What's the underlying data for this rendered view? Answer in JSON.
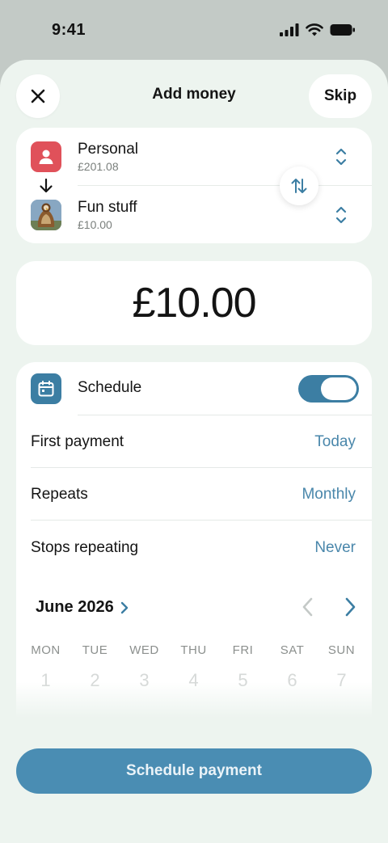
{
  "status": {
    "time": "9:41",
    "icons": [
      "cellular-signal-icon",
      "wifi-icon",
      "battery-icon"
    ]
  },
  "header": {
    "title": "Add money",
    "skip_label": "Skip",
    "close_icon": "close-icon"
  },
  "transfer": {
    "from": {
      "name": "Personal",
      "balance": "£201.08",
      "icon": "person-icon"
    },
    "to": {
      "name": "Fun stuff",
      "balance": "£10.00",
      "icon": "pot-photo"
    },
    "swap_icon": "swap-arrows-icon"
  },
  "amount": {
    "value": "£10.00"
  },
  "schedule": {
    "label": "Schedule",
    "enabled": true,
    "rows": [
      {
        "label": "First payment",
        "value": "Today"
      },
      {
        "label": "Repeats",
        "value": "Monthly"
      },
      {
        "label": "Stops repeating",
        "value": "Never"
      }
    ]
  },
  "calendar": {
    "month": "June 2026",
    "weekdays": [
      "MON",
      "TUE",
      "WED",
      "THU",
      "FRI",
      "SAT",
      "SUN"
    ],
    "days": [
      "1",
      "2",
      "3",
      "4",
      "5",
      "6",
      "7"
    ]
  },
  "cta": {
    "label": "Schedule payment"
  },
  "colors": {
    "accent": "#3c7ea3",
    "cta": "#4a8db3",
    "link": "#4a87ab",
    "sheet_bg": "#edf4ef",
    "personal_icon": "#e0515a"
  }
}
